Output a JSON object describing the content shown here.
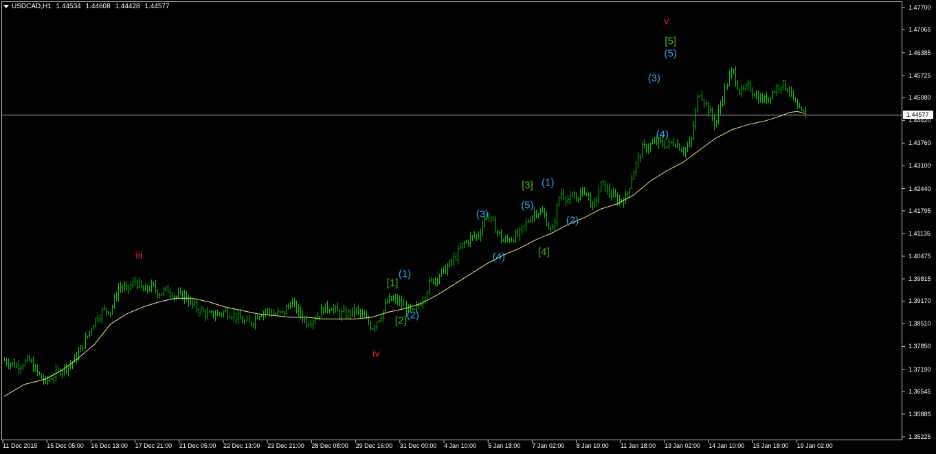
{
  "chart_header": {
    "symbol_timeframe": "USDCAD,H1",
    "open": "1.44534",
    "high": "1.44608",
    "low": "1.44428",
    "close": "1.44577"
  },
  "current_price_label": "1.44577",
  "colors": {
    "background": "#000000",
    "candles": "#00c800",
    "moving_average": "#f0e68c",
    "price_line": "#c0c0c0",
    "wave_red": "#e02020",
    "wave_green": "#44bb22",
    "wave_blue": "#2aa8f0",
    "text": "#ffffff"
  },
  "chart_data": {
    "type": "bar",
    "y_ticks": [
      "1.47700",
      "1.47065",
      "1.46385",
      "1.45725",
      "1.45080",
      "1.44420",
      "1.43760",
      "1.43100",
      "1.42440",
      "1.41795",
      "1.41135",
      "1.40475",
      "1.39815",
      "1.39170",
      "1.38510",
      "1.37850",
      "1.37190",
      "1.36545",
      "1.35885",
      "1.35225"
    ],
    "x_ticks": [
      "11 Dec 2015",
      "15 Dec 05:00",
      "16 Dec 13:00",
      "17 Dec 21:00",
      "21 Dec 05:00",
      "22 Dec 13:00",
      "23 Dec 21:00",
      "28 Dec 08:00",
      "29 Dec 16:00",
      "31 Dec 00:00",
      "4 Jan 10:00",
      "5 Jan 18:00",
      "7 Jan 02:00",
      "8 Jan 10:00",
      "11 Jan 18:00",
      "13 Jan 02:00",
      "14 Jan 10:00",
      "15 Jan 18:00",
      "19 Jan 02:00"
    ],
    "ylim": [
      1.35225,
      1.477
    ],
    "current_price": 1.44577,
    "price_path": [
      [
        0,
        1.3745
      ],
      [
        3,
        1.373
      ],
      [
        6,
        1.3745
      ],
      [
        8,
        1.371
      ],
      [
        10,
        1.368
      ],
      [
        12,
        1.37
      ],
      [
        14,
        1.372
      ],
      [
        16,
        1.373
      ],
      [
        18,
        1.376
      ],
      [
        22,
        1.386
      ],
      [
        24,
        1.389
      ],
      [
        26,
        1.389
      ],
      [
        28,
        1.396
      ],
      [
        30,
        1.395
      ],
      [
        32,
        1.3975
      ],
      [
        34,
        1.3945
      ],
      [
        36,
        1.396
      ],
      [
        38,
        1.394
      ],
      [
        40,
        1.395
      ],
      [
        42,
        1.393
      ],
      [
        44,
        1.3935
      ],
      [
        46,
        1.3905
      ],
      [
        48,
        1.389
      ],
      [
        50,
        1.3875
      ],
      [
        54,
        1.3885
      ],
      [
        56,
        1.388
      ],
      [
        58,
        1.386
      ],
      [
        60,
        1.385
      ],
      [
        62,
        1.388
      ],
      [
        64,
        1.389
      ],
      [
        66,
        1.388
      ],
      [
        68,
        1.388
      ],
      [
        70,
        1.3915
      ],
      [
        72,
        1.3885
      ],
      [
        74,
        1.3855
      ],
      [
        76,
        1.387
      ],
      [
        78,
        1.3895
      ],
      [
        80,
        1.39
      ],
      [
        82,
        1.388
      ],
      [
        84,
        1.388
      ],
      [
        86,
        1.389
      ],
      [
        88,
        1.387
      ],
      [
        90,
        1.384
      ],
      [
        92,
        1.3875
      ],
      [
        94,
        1.392
      ],
      [
        96,
        1.392
      ],
      [
        98,
        1.39
      ],
      [
        100,
        1.388
      ],
      [
        102,
        1.392
      ],
      [
        104,
        1.397
      ],
      [
        106,
        1.399
      ],
      [
        108,
        1.401
      ],
      [
        110,
        1.404
      ],
      [
        112,
        1.408
      ],
      [
        114,
        1.41
      ],
      [
        116,
        1.411
      ],
      [
        118,
        1.417
      ],
      [
        120,
        1.413
      ],
      [
        122,
        1.409
      ],
      [
        124,
        1.41
      ],
      [
        126,
        1.411
      ],
      [
        128,
        1.415
      ],
      [
        130,
        1.418
      ],
      [
        132,
        1.417
      ],
      [
        134,
        1.411
      ],
      [
        136,
        1.4235
      ],
      [
        138,
        1.421
      ],
      [
        140,
        1.422
      ],
      [
        142,
        1.424
      ],
      [
        144,
        1.4185
      ],
      [
        146,
        1.426
      ],
      [
        148,
        1.423
      ],
      [
        150,
        1.421
      ],
      [
        152,
        1.4215
      ],
      [
        154,
        1.43
      ],
      [
        156,
        1.436
      ],
      [
        158,
        1.437
      ],
      [
        160,
        1.438
      ],
      [
        162,
        1.437
      ],
      [
        164,
        1.438
      ],
      [
        166,
        1.4355
      ],
      [
        168,
        1.4375
      ],
      [
        170,
        1.453
      ],
      [
        172,
        1.448
      ],
      [
        174,
        1.443
      ],
      [
        176,
        1.4525
      ],
      [
        178,
        1.459
      ],
      [
        180,
        1.452
      ],
      [
        182,
        1.454
      ],
      [
        184,
        1.451
      ],
      [
        186,
        1.45
      ],
      [
        188,
        1.4525
      ],
      [
        190,
        1.455
      ],
      [
        192,
        1.453
      ],
      [
        194,
        1.447
      ],
      [
        196,
        1.44577
      ]
    ],
    "ma_path": [
      [
        0,
        1.364
      ],
      [
        5,
        1.3675
      ],
      [
        10,
        1.369
      ],
      [
        14,
        1.3715
      ],
      [
        18,
        1.375
      ],
      [
        22,
        1.379
      ],
      [
        26,
        1.385
      ],
      [
        30,
        1.388
      ],
      [
        34,
        1.39
      ],
      [
        38,
        1.3915
      ],
      [
        42,
        1.3925
      ],
      [
        46,
        1.3925
      ],
      [
        50,
        1.3915
      ],
      [
        54,
        1.39
      ],
      [
        58,
        1.389
      ],
      [
        62,
        1.388
      ],
      [
        66,
        1.3875
      ],
      [
        70,
        1.387
      ],
      [
        74,
        1.387
      ],
      [
        78,
        1.3865
      ],
      [
        82,
        1.3865
      ],
      [
        86,
        1.3865
      ],
      [
        90,
        1.387
      ],
      [
        94,
        1.3885
      ],
      [
        98,
        1.3895
      ],
      [
        102,
        1.391
      ],
      [
        106,
        1.3935
      ],
      [
        110,
        1.3965
      ],
      [
        114,
        1.3995
      ],
      [
        118,
        1.4025
      ],
      [
        122,
        1.405
      ],
      [
        126,
        1.407
      ],
      [
        130,
        1.4095
      ],
      [
        134,
        1.4115
      ],
      [
        138,
        1.414
      ],
      [
        142,
        1.416
      ],
      [
        146,
        1.4185
      ],
      [
        150,
        1.42
      ],
      [
        154,
        1.4225
      ],
      [
        158,
        1.4265
      ],
      [
        162,
        1.4295
      ],
      [
        166,
        1.432
      ],
      [
        170,
        1.4355
      ],
      [
        174,
        1.439
      ],
      [
        178,
        1.4415
      ],
      [
        182,
        1.443
      ],
      [
        186,
        1.444
      ],
      [
        190,
        1.4455
      ],
      [
        192,
        1.4465
      ],
      [
        194,
        1.4468
      ],
      [
        196,
        1.4462
      ]
    ],
    "wave_labels": [
      {
        "text": "iii",
        "color": "red",
        "x": 33,
        "y": 1.405
      },
      {
        "text": "iv",
        "color": "red",
        "x": 91,
        "y": 1.3765
      },
      {
        "text": "v",
        "color": "red",
        "x": 162,
        "y": 1.473
      },
      {
        "text": "[1]",
        "color": "green",
        "x": 95,
        "y": 1.397
      },
      {
        "text": "[2]",
        "color": "green",
        "x": 97,
        "y": 1.386
      },
      {
        "text": "[3]",
        "color": "green",
        "x": 128,
        "y": 1.4253
      },
      {
        "text": "[4]",
        "color": "green",
        "x": 132,
        "y": 1.406
      },
      {
        "text": "[5]",
        "color": "green",
        "x": 163,
        "y": 1.4673
      },
      {
        "text": "(1)",
        "color": "blue",
        "x": 98,
        "y": 1.3995
      },
      {
        "text": "(2)",
        "color": "blue",
        "x": 100,
        "y": 1.3875
      },
      {
        "text": "(3)",
        "color": "blue",
        "x": 117,
        "y": 1.417
      },
      {
        "text": "(4)",
        "color": "blue",
        "x": 121,
        "y": 1.4045
      },
      {
        "text": "(5)",
        "color": "blue",
        "x": 128,
        "y": 1.4195
      },
      {
        "text": "(1)",
        "color": "blue",
        "x": 133,
        "y": 1.4262
      },
      {
        "text": "(2)",
        "color": "blue",
        "x": 139,
        "y": 1.4152
      },
      {
        "text": "(3)",
        "color": "blue",
        "x": 159,
        "y": 1.4565
      },
      {
        "text": "(4)",
        "color": "blue",
        "x": 161,
        "y": 1.44
      },
      {
        "text": "(5)",
        "color": "blue",
        "x": 163,
        "y": 1.4636
      }
    ]
  }
}
